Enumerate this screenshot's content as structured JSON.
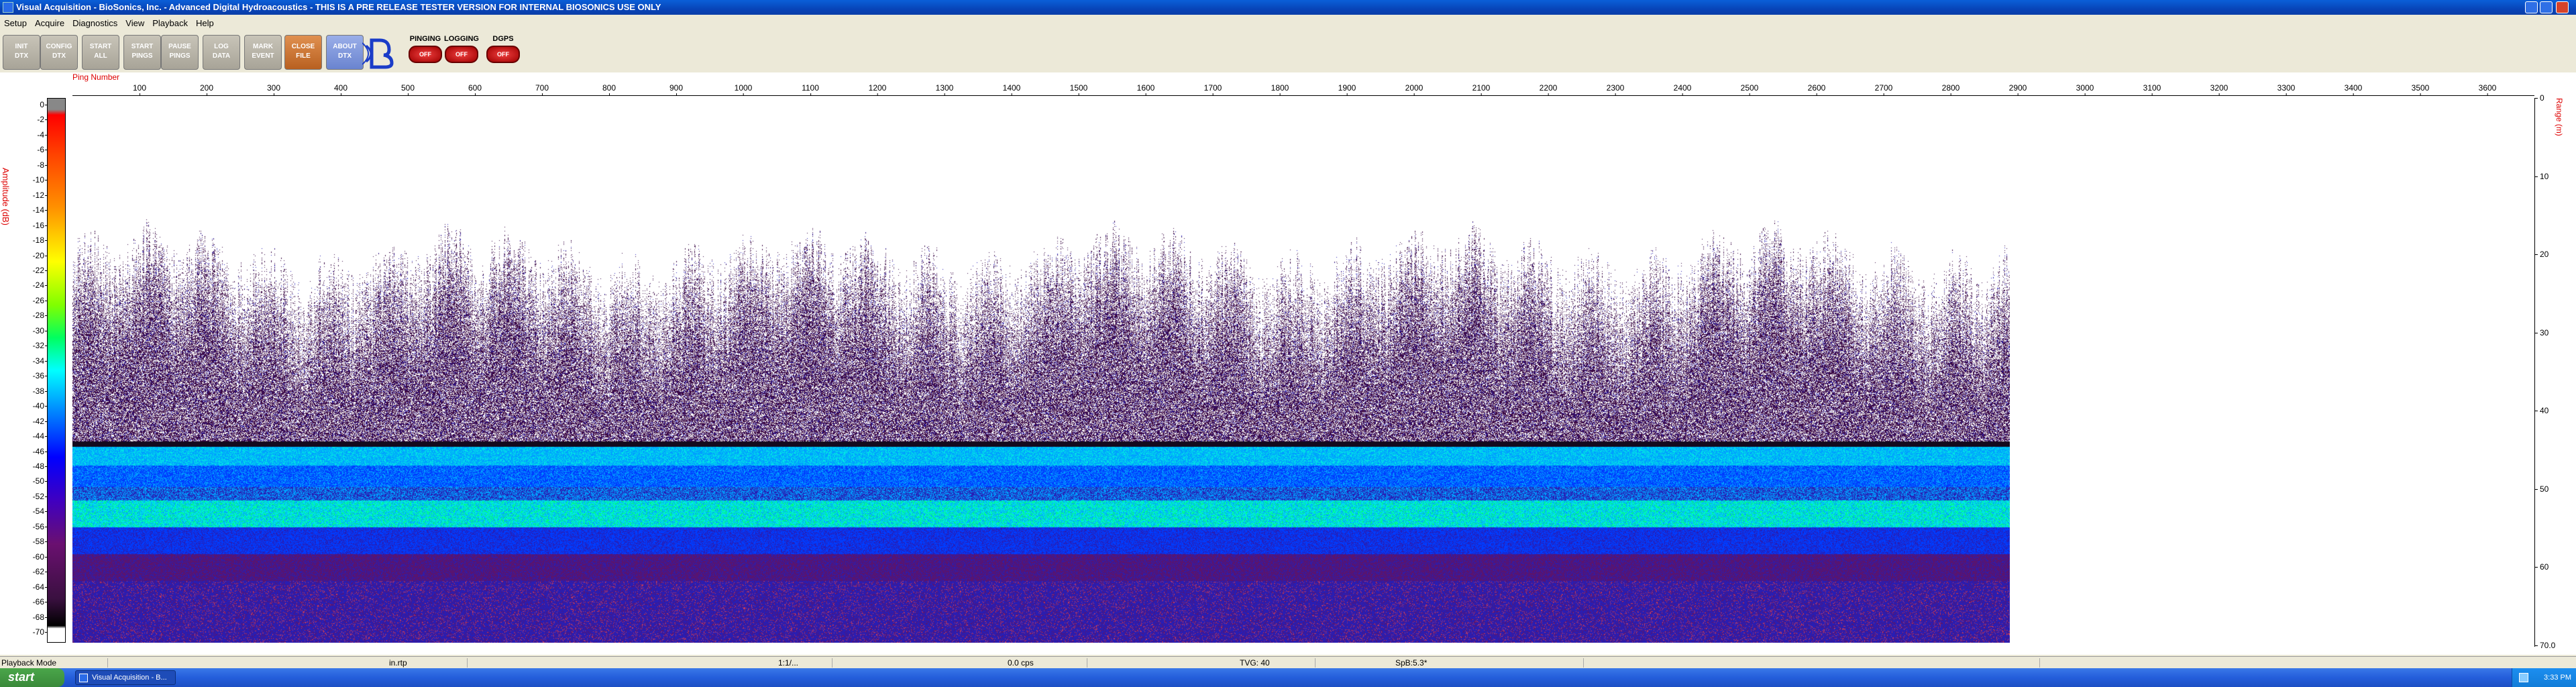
{
  "window": {
    "title": "Visual Acquisition  -  BioSonics, Inc.   -  Advanced Digital Hydroacoustics   -  THIS IS A PRE RELEASE TESTER VERSION FOR INTERNAL BIOSONICS USE ONLY"
  },
  "menu": [
    "Setup",
    "Acquire",
    "Diagnostics",
    "View",
    "Playback",
    "Help"
  ],
  "toolbar": {
    "buttons": [
      "INIT\nDTX",
      "CONFIG\nDTX",
      "START\nALL",
      "START\nPINGS",
      "PAUSE\nPINGS",
      "LOG\nDATA",
      "MARK\nEVENT",
      "CLOSE\nFILE",
      "ABOUT\nDTX"
    ],
    "indicators": [
      {
        "label": "PINGING",
        "state": "OFF"
      },
      {
        "label": "LOGGING",
        "state": "OFF"
      },
      {
        "label": "DGPS",
        "state": "OFF"
      }
    ]
  },
  "echogram": {
    "amplitude_title": "Amplitude (dB)",
    "ping_label": "Ping Number",
    "range_title": "Range (m)",
    "amplitude_ticks": [
      "0",
      "-2",
      "-4",
      "-6",
      "-8",
      "-10",
      "-12",
      "-14",
      "-16",
      "-18",
      "-20",
      "-22",
      "-24",
      "-26",
      "-28",
      "-30",
      "-32",
      "-34",
      "-36",
      "-38",
      "-40",
      "-42",
      "-44",
      "-46",
      "-48",
      "-50",
      "-52",
      "-54",
      "-56",
      "-58",
      "-60",
      "-62",
      "-64",
      "-66",
      "-68",
      "-70"
    ],
    "ping_ticks": [
      "100",
      "200",
      "300",
      "400",
      "500",
      "600",
      "700",
      "800",
      "900",
      "1000",
      "1100",
      "1200",
      "1300",
      "1400",
      "1500",
      "1600",
      "1700",
      "1800",
      "1900",
      "2000",
      "2100",
      "2200",
      "2300",
      "2400",
      "2500",
      "2600",
      "2700",
      "2800",
      "2900",
      "3000",
      "3100",
      "3200",
      "3300",
      "3400",
      "3500",
      "3600"
    ],
    "range_ticks": [
      "0",
      "10",
      "20",
      "30",
      "40",
      "50",
      "60",
      "70.0"
    ],
    "amplitude_range": [
      -70,
      0
    ],
    "ping_range": [
      0,
      3650
    ],
    "range_m": [
      0,
      70
    ],
    "pings_recorded": 2890
  },
  "status": {
    "mode": "Playback Mode",
    "file": "in.rtp",
    "f2": "1:1/...",
    "rate": "0.0 cps",
    "tvg": "TVG: 40",
    "sps": "SpB:5.3*"
  },
  "taskbar": {
    "start": "start",
    "task": "Visual Acquisition  -  B...",
    "clock": "3:33 PM"
  },
  "colors": {
    "titlebar": "#0844b8",
    "axis_title": "#dd0000",
    "taskbar": "#245edb"
  }
}
